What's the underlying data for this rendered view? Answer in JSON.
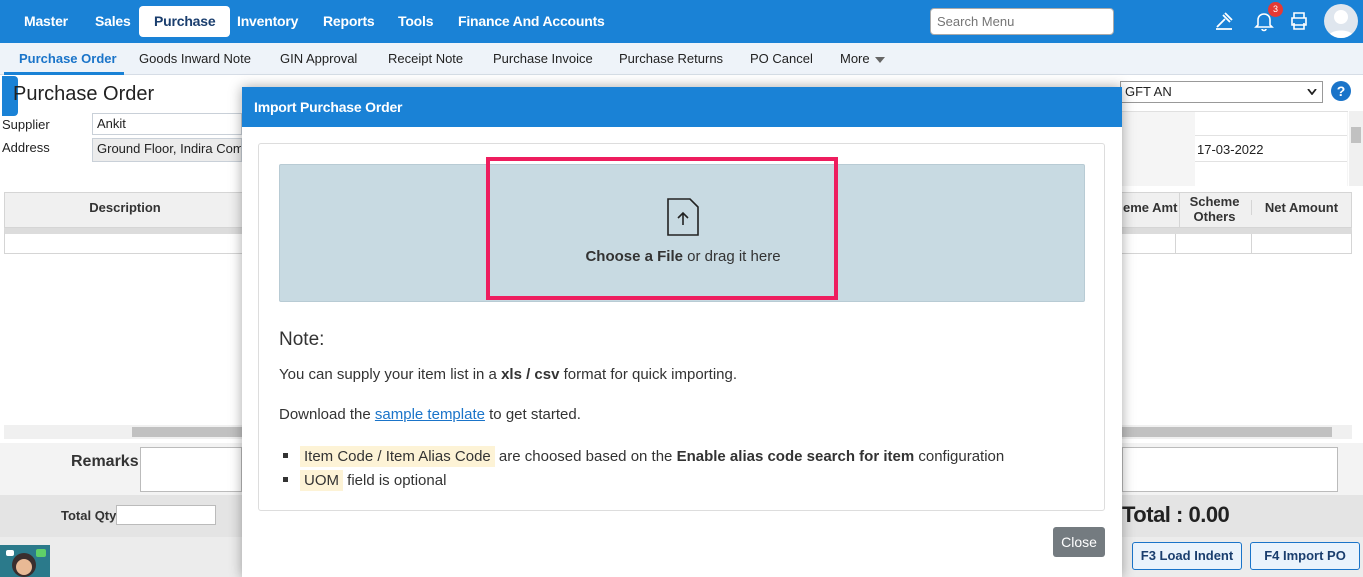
{
  "topnav": {
    "items": [
      "Master",
      "Sales",
      "Purchase",
      "Inventory",
      "Reports",
      "Tools",
      "Finance And Accounts"
    ],
    "active": "Purchase",
    "search_placeholder": "Search Menu",
    "notification_count": "3",
    "icons": [
      "hammer-icon",
      "bell-icon",
      "printer-icon",
      "user-avatar-icon"
    ]
  },
  "subnav": {
    "items": [
      "Purchase Order",
      "Goods Inward Note",
      "GIN Approval",
      "Receipt Note",
      "Purchase Invoice",
      "Purchase Returns",
      "PO Cancel",
      "More"
    ],
    "active": "Purchase Order"
  },
  "page": {
    "title": "Purchase Order",
    "supplier_label": "Supplier",
    "supplier_value": "Ankit",
    "address_label": "Address",
    "address_value": "Ground Floor, Indira Comp",
    "branch_select": "GFT AN",
    "date_value": "17-03-2022",
    "grid_headers": {
      "description": "Description",
      "scheme_amt": "eme Amt",
      "scheme_others": "Scheme Others",
      "net_amount": "Net Amount"
    },
    "remarks_label": "Remarks",
    "total_qty_label": "Total Qty",
    "total_label": "Total : 0.00",
    "buttons": {
      "load_indent": "F3 Load Indent",
      "import_po": "F4 Import PO"
    }
  },
  "modal": {
    "title": "Import Purchase Order",
    "dropzone": {
      "choose": "Choose a File",
      "rest": " or drag it here"
    },
    "note_title": "Note:",
    "line1_pre": "You can supply your item list in a ",
    "line1_bold": "xls / csv",
    "line1_post": " format for quick importing.",
    "line2_pre": "Download the ",
    "line2_link": "sample template",
    "line2_post": " to get started.",
    "bullet1_hl": "Item Code / Item Alias Code",
    "bullet1_mid": " are choosed based on the ",
    "bullet1_bold": "Enable alias code search for item",
    "bullet1_post": " configuration",
    "bullet2_hl": "UOM",
    "bullet2_post": " field is optional",
    "close_label": "Close"
  },
  "colors": {
    "primary": "#1a82d6",
    "highlight_border": "#ee1d5e",
    "dropzone_bg": "#c8dae2"
  }
}
